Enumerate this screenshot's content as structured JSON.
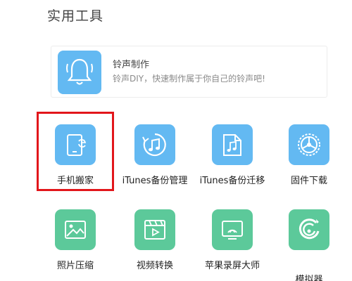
{
  "section": {
    "title": "实用工具"
  },
  "ringtone_card": {
    "title": "铃声制作",
    "description": "铃声DIY，快速制作属于你自己的铃声吧!",
    "icon": "bell-icon"
  },
  "tools": [
    {
      "label": "手机搬家",
      "icon": "phone-transfer-icon",
      "color": "#63b9f2"
    },
    {
      "label": "iTunes备份管理",
      "icon": "itunes-backup-icon",
      "color": "#63b9f2"
    },
    {
      "label": "iTunes备份迁移",
      "icon": "music-folder-icon",
      "color": "#63b9f2"
    },
    {
      "label": "固件下载",
      "icon": "firmware-download-icon",
      "color": "#63b9f2"
    },
    {
      "label": "照片压缩",
      "icon": "photo-icon",
      "color": "#5cc99a"
    },
    {
      "label": "视频转换",
      "icon": "video-icon",
      "color": "#5cc99a"
    },
    {
      "label": "苹果录屏大师",
      "icon": "screen-cast-icon",
      "color": "#5cc99a"
    },
    {
      "label": "模拟器",
      "icon": "simulator-icon",
      "color": "#5cc99a"
    }
  ],
  "colors": {
    "accent_blue": "#63b9f2",
    "accent_green": "#5cc99a",
    "highlight_red": "#e2161b"
  }
}
